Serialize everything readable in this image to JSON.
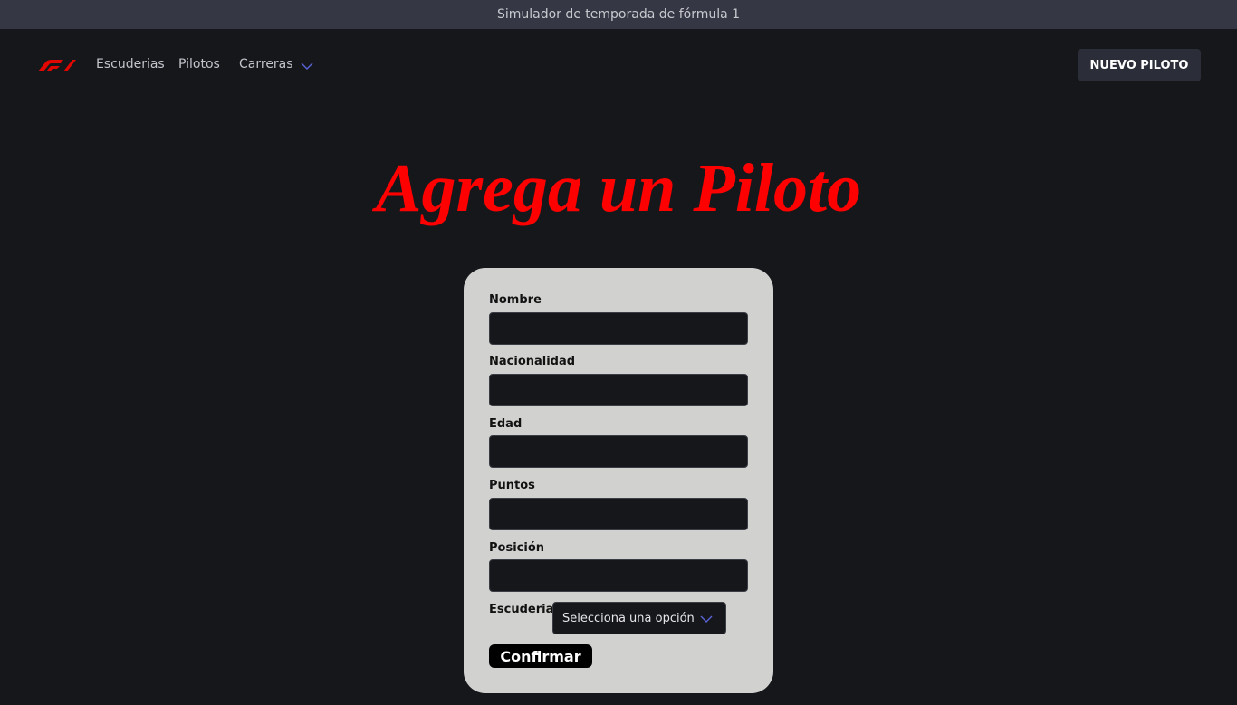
{
  "window": {
    "title": "Simulador de temporada de fórmula 1"
  },
  "navbar": {
    "logo_icon": "f1-logo-icon",
    "links": [
      {
        "label": "Escuderias"
      },
      {
        "label": "Pilotos"
      },
      {
        "label": "Carreras",
        "icon": "chevron-down-icon"
      }
    ],
    "cta_label": "NUEVO PILOTO"
  },
  "page": {
    "title": "Agrega un Piloto"
  },
  "form": {
    "fields": [
      {
        "label": "Nombre",
        "value": ""
      },
      {
        "label": "Nacionalidad",
        "value": ""
      },
      {
        "label": "Edad",
        "value": ""
      },
      {
        "label": "Puntos",
        "value": ""
      },
      {
        "label": "Posición",
        "value": ""
      }
    ],
    "escuderia": {
      "label": "Escuderia",
      "selected": "Selecciona una opción"
    },
    "submit_label": "Confirmar"
  },
  "colors": {
    "accent_red": "#ff0000",
    "background": "#16171b",
    "card": "#d1d2d0",
    "chevron": "#5a64d8"
  }
}
